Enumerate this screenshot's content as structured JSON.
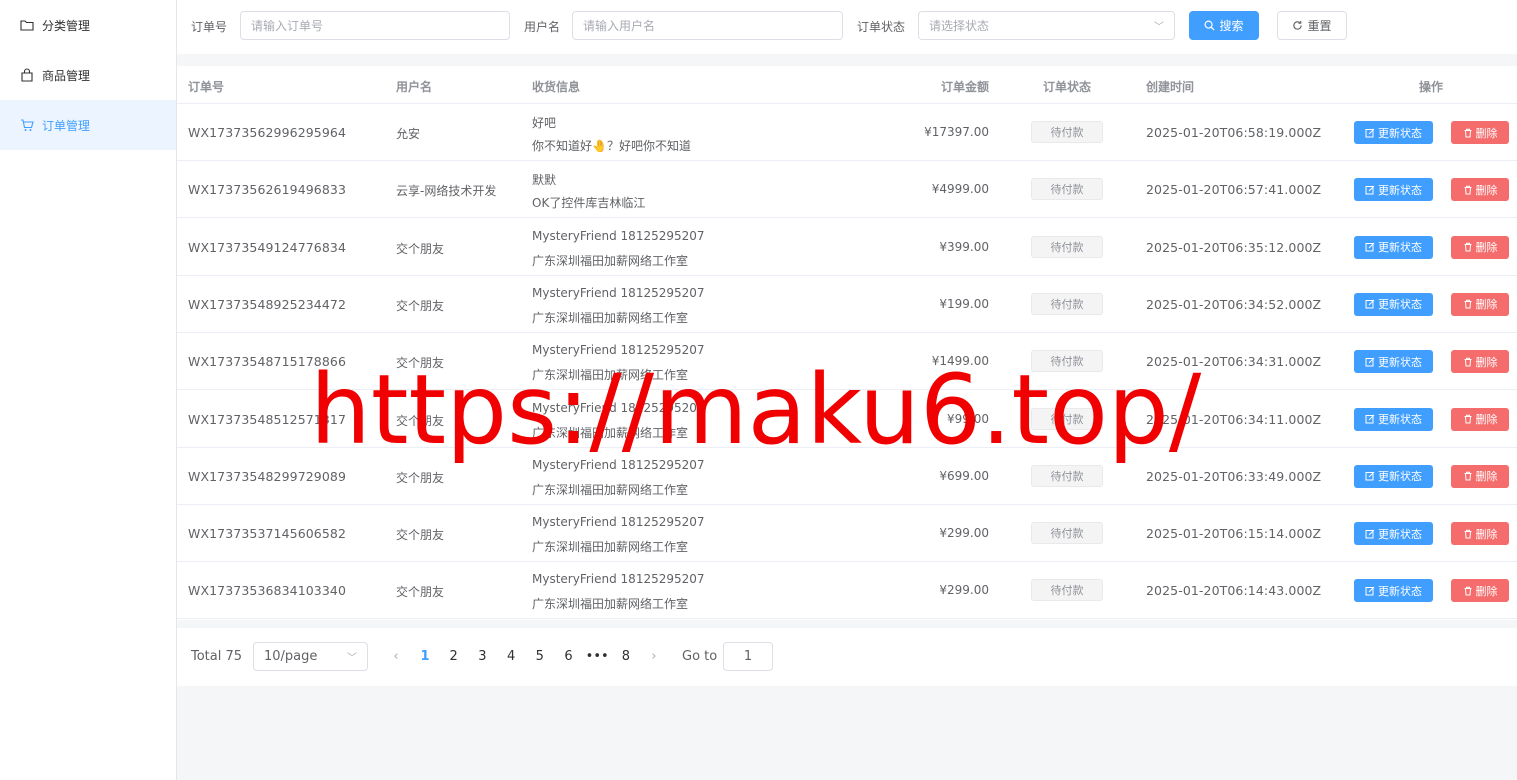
{
  "sidebar": {
    "items": [
      {
        "label": "分类管理",
        "icon": "folder-icon",
        "active": false
      },
      {
        "label": "商品管理",
        "icon": "shopping-bag-icon",
        "active": false
      },
      {
        "label": "订单管理",
        "icon": "shopping-cart-icon",
        "active": true
      }
    ]
  },
  "search": {
    "order_no_label": "订单号",
    "order_no_placeholder": "请输入订单号",
    "username_label": "用户名",
    "username_placeholder": "请输入用户名",
    "status_label": "订单状态",
    "status_placeholder": "请选择状态",
    "search_button": "搜索",
    "reset_button": "重置"
  },
  "table": {
    "columns": [
      "订单号",
      "用户名",
      "收货信息",
      "订单金额",
      "订单状态",
      "创建时间",
      "操作"
    ],
    "rows": [
      {
        "order_no": "WX17373562996295964",
        "user": "允安",
        "ship_line1": "好吧",
        "ship_line2": "你不知道好🤚？好吧你不知道",
        "amount": "¥17397.00",
        "status": "待付款",
        "created": "2025-01-20T06:58:19.000Z"
      },
      {
        "order_no": "WX17373562619496833",
        "user": "云享-网络技术开发",
        "ship_line1": "默默",
        "ship_line2": "OK了控件库吉林临江",
        "amount": "¥4999.00",
        "status": "待付款",
        "created": "2025-01-20T06:57:41.000Z"
      },
      {
        "order_no": "WX17373549124776834",
        "user": "交个朋友",
        "ship_line1": "MysteryFriend  18125295207",
        "ship_line2": "广东深圳福田加薪网络工作室",
        "amount": "¥399.00",
        "status": "待付款",
        "created": "2025-01-20T06:35:12.000Z"
      },
      {
        "order_no": "WX17373548925234472",
        "user": "交个朋友",
        "ship_line1": "MysteryFriend  18125295207",
        "ship_line2": "广东深圳福田加薪网络工作室",
        "amount": "¥199.00",
        "status": "待付款",
        "created": "2025-01-20T06:34:52.000Z"
      },
      {
        "order_no": "WX17373548715178866",
        "user": "交个朋友",
        "ship_line1": "MysteryFriend  18125295207",
        "ship_line2": "广东深圳福田加薪网络工作室",
        "amount": "¥1499.00",
        "status": "待付款",
        "created": "2025-01-20T06:34:31.000Z"
      },
      {
        "order_no": "WX17373548512571317",
        "user": "交个朋友",
        "ship_line1": "MysteryFriend  18125295207",
        "ship_line2": "广东深圳福田加薪网络工作室",
        "amount": "¥99.00",
        "status": "待付款",
        "created": "2025-01-20T06:34:11.000Z"
      },
      {
        "order_no": "WX17373548299729089",
        "user": "交个朋友",
        "ship_line1": "MysteryFriend  18125295207",
        "ship_line2": "广东深圳福田加薪网络工作室",
        "amount": "¥699.00",
        "status": "待付款",
        "created": "2025-01-20T06:33:49.000Z"
      },
      {
        "order_no": "WX17373537145606582",
        "user": "交个朋友",
        "ship_line1": "MysteryFriend  18125295207",
        "ship_line2": "广东深圳福田加薪网络工作室",
        "amount": "¥299.00",
        "status": "待付款",
        "created": "2025-01-20T06:15:14.000Z"
      },
      {
        "order_no": "WX17373536834103340",
        "user": "交个朋友",
        "ship_line1": "MysteryFriend  18125295207",
        "ship_line2": "广东深圳福田加薪网络工作室",
        "amount": "¥299.00",
        "status": "待付款",
        "created": "2025-01-20T06:14:43.000Z"
      }
    ],
    "update_button": "更新状态",
    "delete_button": "删除"
  },
  "pagination": {
    "total": "Total 75",
    "page_size": "10/page",
    "pages": [
      "1",
      "2",
      "3",
      "4",
      "5",
      "6",
      "•••",
      "8"
    ],
    "current_page": "1",
    "goto_label": "Go to",
    "goto_value": "1",
    "prev_icon": "chevron-left-icon",
    "next_icon": "chevron-right-icon"
  },
  "watermark": "https://maku6.top/",
  "colors": {
    "primary": "#409eff",
    "danger": "#f56c6c",
    "active_menu_bg": "#ecf5ff",
    "watermark": "#f00000"
  }
}
